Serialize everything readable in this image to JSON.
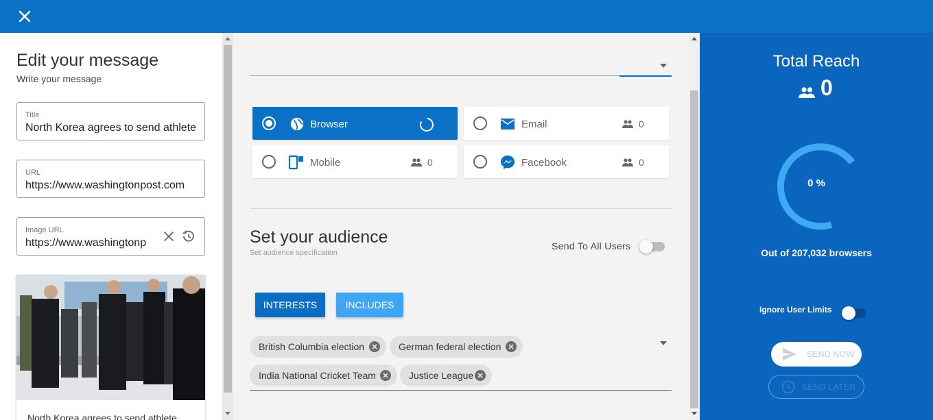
{
  "header": {
    "close_icon": "close-icon"
  },
  "editor": {
    "title": "Edit your message",
    "subtitle": "Write your message",
    "title_field": {
      "label": "Title",
      "value": "North Korea agrees to send athlete"
    },
    "url_field": {
      "label": "URL",
      "value": "https://www.washingtonpost.com"
    },
    "image_url_field": {
      "label": "Image URL",
      "value": "https://www.washingtonp"
    },
    "preview_caption": "North Korea agrees to send athlete"
  },
  "channels": [
    {
      "name": "Browser",
      "icon": "globe-icon",
      "selected": true,
      "loading": true
    },
    {
      "name": "Email",
      "icon": "email-icon",
      "count": "0"
    },
    {
      "name": "Mobile",
      "icon": "mobile-icon",
      "count": "0"
    },
    {
      "name": "Facebook",
      "icon": "messenger-icon",
      "count": "0"
    }
  ],
  "audience": {
    "title": "Set your audience",
    "subtitle": "Set audience specification",
    "send_to_all_label": "Send To All Users",
    "send_to_all": false,
    "buttons": {
      "interests": "INTERESTS",
      "includes": "INCLUDES"
    },
    "chips": [
      "British Columbia election",
      "German federal election",
      "India National Cricket Team",
      "Justice League"
    ]
  },
  "reach": {
    "title": "Total Reach",
    "count": "0",
    "percent_label": "0 %",
    "percent": 0,
    "out_of": "Out of 207,032 browsers",
    "ignore_limits_label": "Ignore User Limits",
    "ignore_limits": false,
    "send_now": "SEND NOW",
    "send_later": "SEND LATER"
  },
  "colors": {
    "brand_blue": "#0a72c6",
    "panel_blue": "#0a65bf",
    "accent_light_blue": "#3ea6f5",
    "gauge_color": "#3daaf3"
  }
}
